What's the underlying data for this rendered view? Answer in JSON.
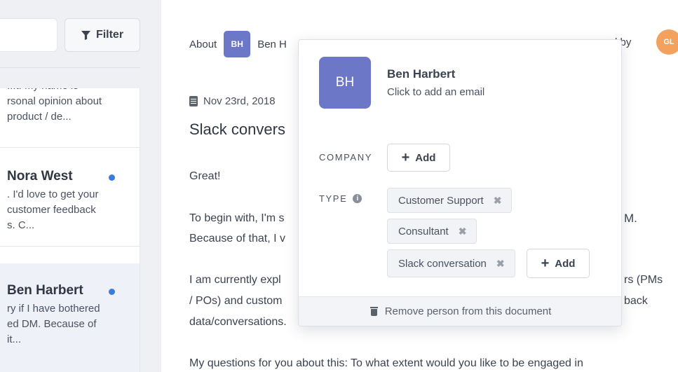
{
  "sidebar": {
    "filter_label": "Filter",
    "items": [
      {
        "name": "",
        "snippet_lines": [
          "...t. My name is",
          "rsonal opinion about",
          "product / de..."
        ],
        "unread": false
      },
      {
        "name": "Nora West",
        "snippet_lines": [
          ". I'd love to get your",
          "customer feedback",
          "s. C..."
        ],
        "unread": true
      },
      {
        "name": "Ben Harbert",
        "snippet_lines": [
          "ry if I have bothered",
          "ed DM. Because of",
          "it..."
        ],
        "unread": true
      }
    ]
  },
  "doc": {
    "about_label": "About",
    "about_person_initials": "BH",
    "about_person_name": "Ben H",
    "edited_by_label": "d by",
    "editor_initials": "GL",
    "date": "Nov 23rd, 2018",
    "title": "Slack convers",
    "paragraphs": [
      "Great!",
      "To begin with, I'm s",
      "M.",
      "Because of that, I v",
      "I am currently expl",
      "rs (PMs",
      "/ POs) and custom",
      "back",
      "data/conversations.",
      "My questions for you about this: To what extent would you like to be engaged in"
    ]
  },
  "popover": {
    "initials": "BH",
    "name": "Ben Harbert",
    "email_placeholder": "Click to add an email",
    "company_label": "COMPANY",
    "add_label": "Add",
    "type_label": "TYPE",
    "tags": [
      "Customer Support",
      "Consultant",
      "Slack conversation"
    ],
    "remove_label": "Remove person from this document"
  },
  "colors": {
    "avatar": "#6c77c8",
    "editor_avatar": "#f3a15c",
    "unread_dot": "#3a7be0"
  }
}
